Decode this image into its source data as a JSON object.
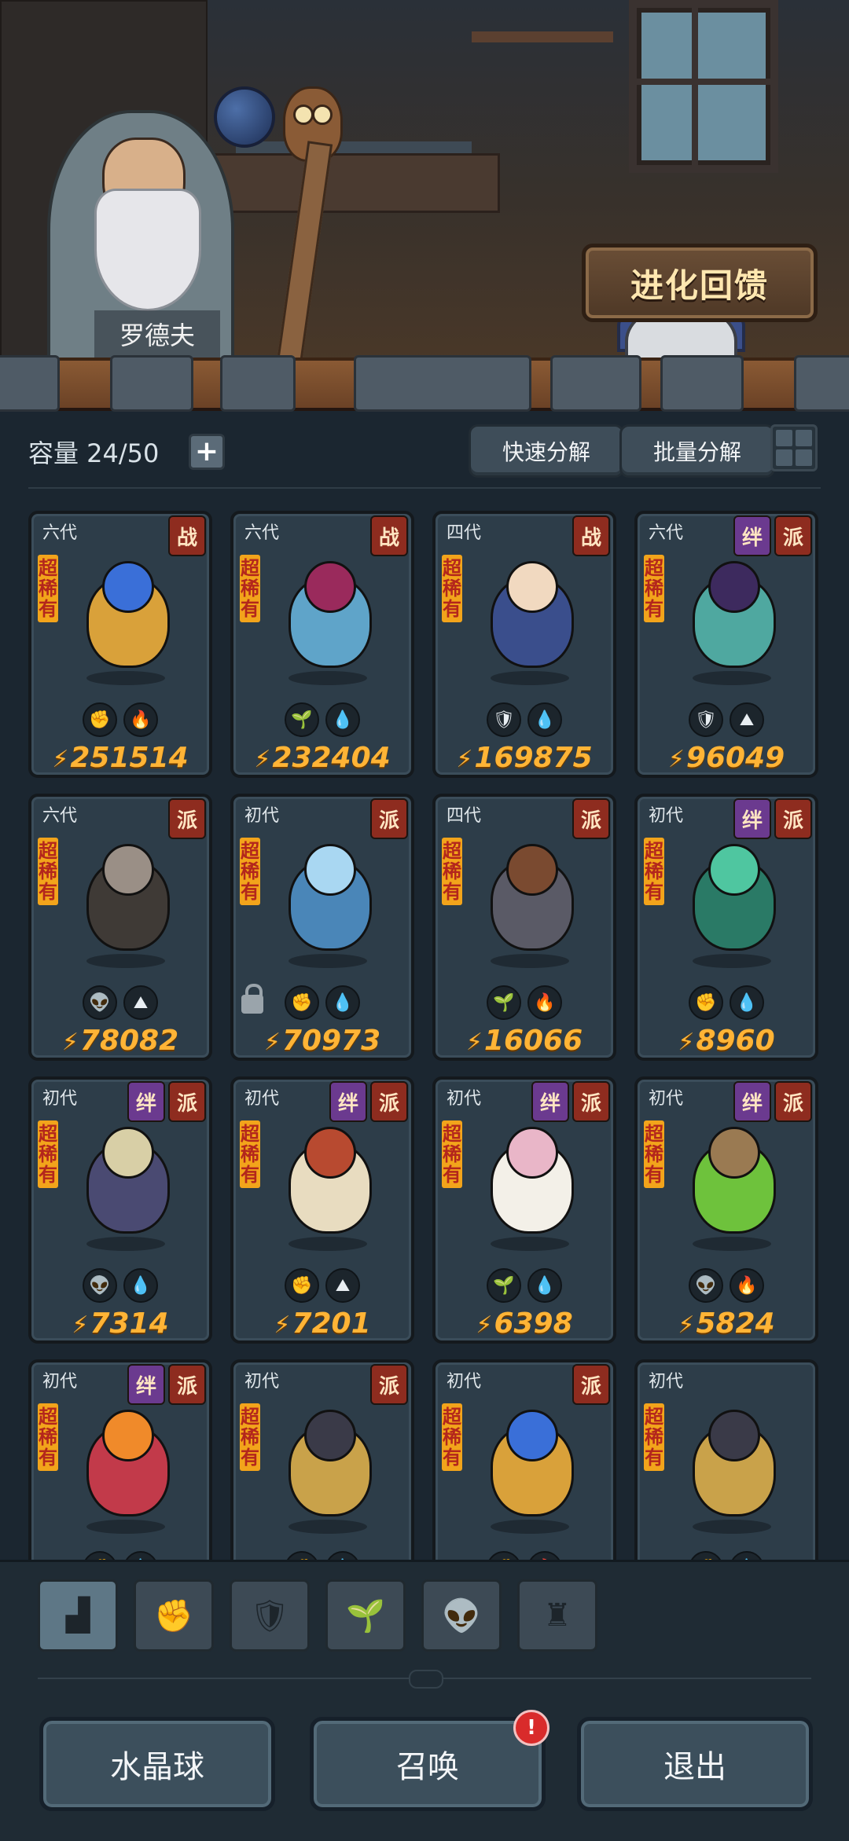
{
  "scene": {
    "npc_name": "罗德夫",
    "evolve_label": "进化回馈"
  },
  "toolbar": {
    "capacity": "容量 24/50",
    "quick_decompose": "快速分解",
    "batch_decompose": "批量分解"
  },
  "cards": [
    {
      "gen": "六代",
      "badges": [
        "战"
      ],
      "rarity": "超稀有",
      "tags": [
        "fist",
        "fire"
      ],
      "power": "251514",
      "colors": [
        "#3a6fd8",
        "#d9a13a"
      ]
    },
    {
      "gen": "六代",
      "badges": [
        "战"
      ],
      "rarity": "超稀有",
      "tags": [
        "sprout",
        "water"
      ],
      "power": "232404",
      "colors": [
        "#9a2a5c",
        "#5fa4c9"
      ]
    },
    {
      "gen": "四代",
      "badges": [
        "战"
      ],
      "rarity": "超稀有",
      "tags": [
        "shield",
        "water"
      ],
      "power": "169875",
      "colors": [
        "#f1d9c0",
        "#3a4e8c"
      ]
    },
    {
      "gen": "六代",
      "badges": [
        "绊",
        "派"
      ],
      "rarity": "超稀有",
      "tags": [
        "shield",
        "earth"
      ],
      "power": "96049",
      "colors": [
        "#3d2a5e",
        "#4fa8a0"
      ]
    },
    {
      "gen": "六代",
      "badges": [
        "派"
      ],
      "rarity": "超稀有",
      "tags": [
        "alien",
        "earth"
      ],
      "power": "78082",
      "colors": [
        "#9a8f86",
        "#3f3a36"
      ]
    },
    {
      "gen": "初代",
      "badges": [
        "派"
      ],
      "rarity": "超稀有",
      "tags": [
        "fist",
        "water"
      ],
      "power": "70973",
      "colors": [
        "#a9d7f2",
        "#4a86b8"
      ],
      "locked": true
    },
    {
      "gen": "四代",
      "badges": [
        "派"
      ],
      "rarity": "超稀有",
      "tags": [
        "sprout",
        "fire"
      ],
      "power": "16066",
      "colors": [
        "#7a4a30",
        "#5a5a66"
      ]
    },
    {
      "gen": "初代",
      "badges": [
        "绊",
        "派"
      ],
      "rarity": "超稀有",
      "tags": [
        "fist",
        "water"
      ],
      "power": "8960",
      "colors": [
        "#4fc6a0",
        "#2a7a66"
      ]
    },
    {
      "gen": "初代",
      "badges": [
        "绊",
        "派"
      ],
      "rarity": "超稀有",
      "tags": [
        "alien",
        "water"
      ],
      "power": "7314",
      "colors": [
        "#d8cfa6",
        "#4a4a72"
      ]
    },
    {
      "gen": "初代",
      "badges": [
        "绊",
        "派"
      ],
      "rarity": "超稀有",
      "tags": [
        "fist",
        "earth"
      ],
      "power": "7201",
      "colors": [
        "#b84a30",
        "#e8dcc0"
      ]
    },
    {
      "gen": "初代",
      "badges": [
        "绊",
        "派"
      ],
      "rarity": "超稀有",
      "tags": [
        "sprout",
        "water"
      ],
      "power": "6398",
      "colors": [
        "#e9b6c8",
        "#f3f0e8"
      ]
    },
    {
      "gen": "初代",
      "badges": [
        "绊",
        "派"
      ],
      "rarity": "超稀有",
      "tags": [
        "alien",
        "fire"
      ],
      "power": "5824",
      "colors": [
        "#9a7a52",
        "#6ec23c"
      ]
    },
    {
      "gen": "初代",
      "badges": [
        "绊",
        "派"
      ],
      "rarity": "超稀有",
      "tags": [
        "fist",
        "water"
      ],
      "power": "",
      "colors": [
        "#f08a2a",
        "#c23a4a"
      ]
    },
    {
      "gen": "初代",
      "badges": [
        "派"
      ],
      "rarity": "超稀有",
      "tags": [
        "fist",
        "water"
      ],
      "power": "",
      "colors": [
        "#3a3a48",
        "#c9a24a"
      ]
    },
    {
      "gen": "初代",
      "badges": [
        "派"
      ],
      "rarity": "超稀有",
      "tags": [
        "fist",
        "fire"
      ],
      "power": "",
      "colors": [
        "#3a6fd8",
        "#d9a13a"
      ]
    },
    {
      "gen": "初代",
      "badges": [],
      "rarity": "超稀有",
      "tags": [
        "fist",
        "water"
      ],
      "power": "",
      "colors": [
        "#3a3a48",
        "#c9a24a"
      ]
    }
  ],
  "tag_icons": {
    "fist": "✊",
    "fire": "🔥",
    "sprout": "🌱",
    "water": "💧",
    "shield": "🛡",
    "earth": "⛰",
    "alien": "👽"
  },
  "filters": [
    {
      "name": "filter-all-icon",
      "glyph": "▟",
      "active": true
    },
    {
      "name": "filter-fist-icon",
      "glyph": "✊",
      "active": false
    },
    {
      "name": "filter-shield-icon",
      "glyph": "🛡",
      "active": false
    },
    {
      "name": "filter-sprout-icon",
      "glyph": "🌱",
      "active": false
    },
    {
      "name": "filter-alien-icon",
      "glyph": "👽",
      "active": false
    },
    {
      "name": "filter-tower-icon",
      "glyph": "♜",
      "active": false
    }
  ],
  "bottom": {
    "crystal_ball": "水晶球",
    "summon": "召唤",
    "summon_alert": "!",
    "exit": "退出"
  },
  "colors": {
    "power": "#ffb436",
    "rarity_bg": "#f2a41b",
    "rarity_text": "#b3261c",
    "badge_red": "#8e2c1f",
    "badge_purple": "#6b3a8f"
  }
}
